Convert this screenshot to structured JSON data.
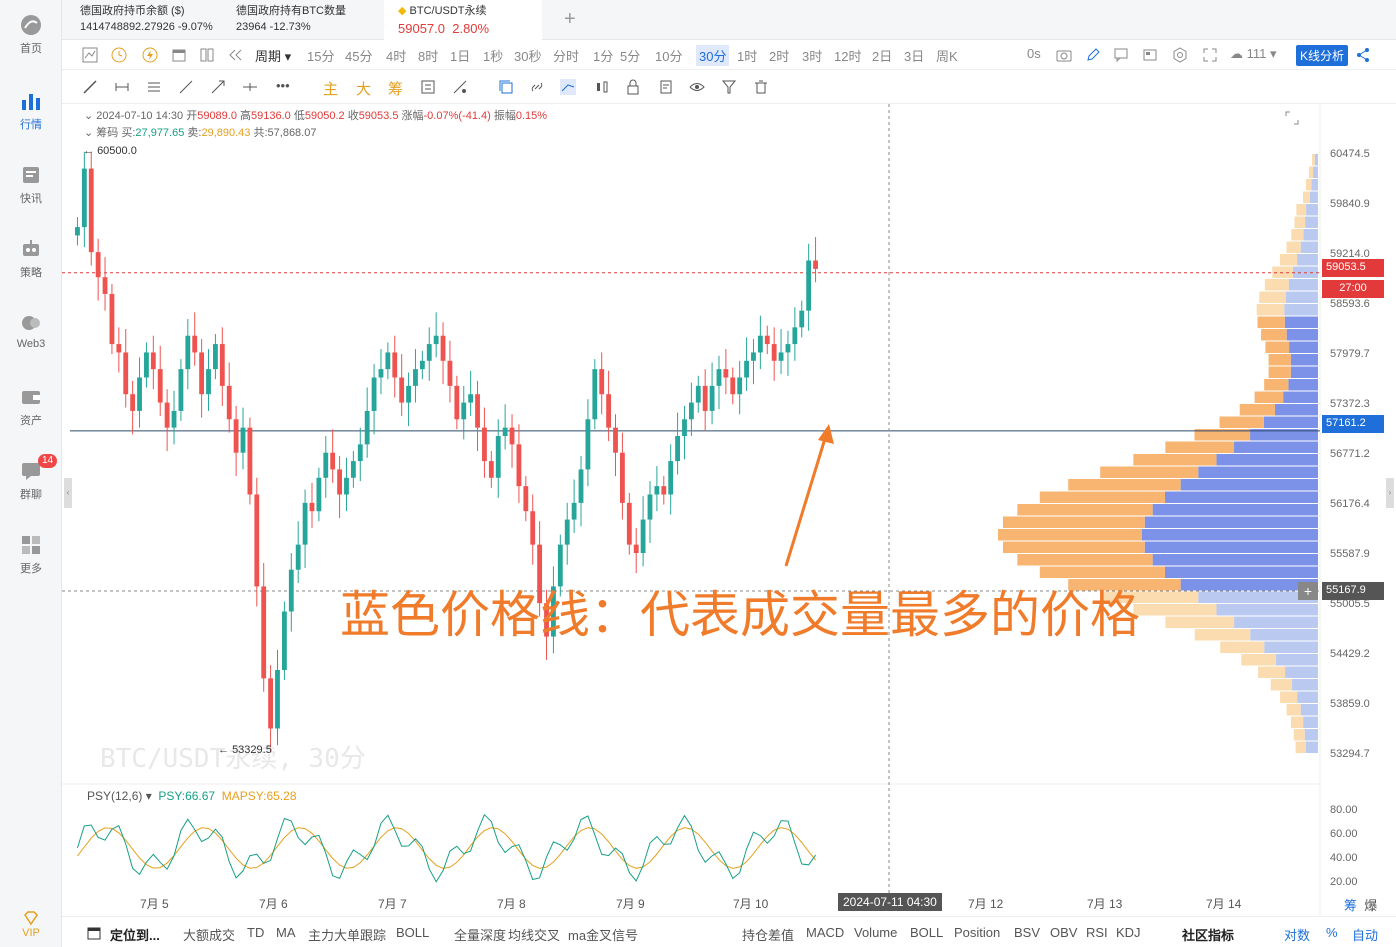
{
  "sidebar": {
    "items": [
      {
        "label": "首页"
      },
      {
        "label": "行情"
      },
      {
        "label": "快讯"
      },
      {
        "label": "策略"
      },
      {
        "label": "Web3"
      },
      {
        "label": "资产"
      },
      {
        "label": "群聊",
        "badge": "14"
      },
      {
        "label": "更多"
      }
    ],
    "vip": "VIP"
  },
  "tabs": [
    {
      "title": "德国政府持币余额 ($)",
      "value": "1414748892.27926",
      "change": "-9.07%"
    },
    {
      "title": "德国政府持有BTC数量",
      "value": "23964",
      "change": "-12.73%"
    },
    {
      "title": "BTC/USDT永续",
      "value": "59057.0",
      "change": "2.80%"
    }
  ],
  "toolbar": {
    "period_label": "周期",
    "intervals": [
      "15分",
      "45分",
      "4时",
      "8时",
      "1日",
      "1秒",
      "30秒",
      "分时",
      "1分",
      "5分",
      "10分",
      "30分",
      "1时",
      "2时",
      "3时",
      "12时",
      "2日",
      "3日",
      "周K"
    ],
    "selected": "30分",
    "countdown": "0s",
    "cloud_count": "111",
    "kline_btn": "K线分析"
  },
  "indicators_bar": [
    "主",
    "大",
    "筹"
  ],
  "ohlc": {
    "date": "2024-07-10 14:30",
    "open_label": "开",
    "open": "59089.0",
    "high_label": "高",
    "high": "59136.0",
    "low_label": "低",
    "low": "59050.2",
    "close_label": "收",
    "close": "59053.5",
    "chg_label": "涨幅",
    "chg": "-0.07%(-41.4)",
    "amp_label": "振幅",
    "amp": "0.15%"
  },
  "chips": {
    "label": "筹码",
    "buy_label": "买:",
    "buy": "27,977.65",
    "sell_label": "卖:",
    "sell": "29,890.43",
    "total_label": "共:",
    "total": "57,868.07"
  },
  "price_axis": [
    "60474.5",
    "59840.9",
    "59214.0",
    "58593.6",
    "57979.7",
    "57372.3",
    "56771.2",
    "56176.4",
    "55587.9",
    "55005.5",
    "54429.2",
    "53859.0",
    "53294.7"
  ],
  "price_tags": {
    "current": "59053.5",
    "countdown": "27:00",
    "poc": "57161.2",
    "cursor": "55167.9"
  },
  "markers": {
    "high": "60500.0",
    "low": "53329.5"
  },
  "watermark": "BTC/USDT永续, 30分",
  "annotation": "蓝色价格线：代表成交量最多的价格",
  "psy": {
    "name": "PSY(12,6)",
    "psy": "PSY:66.67",
    "mapsy": "MAPSY:65.28",
    "axis": [
      "80.00",
      "60.00",
      "40.00",
      "20.00"
    ]
  },
  "date_axis": [
    "7月 5",
    "7月 6",
    "7月 7",
    "7月 8",
    "7月 9",
    "7月 10",
    "7月 12",
    "7月 13",
    "7月 14"
  ],
  "cursor_date": "2024-07-11 04:30",
  "corner": [
    "筹",
    "爆"
  ],
  "bottom_left": [
    "定位到...",
    "大额成交",
    "TD",
    "MA",
    "主力大单跟踪",
    "BOLL",
    "全量深度",
    "均线交叉",
    "ma金叉信号"
  ],
  "bottom_right": [
    "持仓差值",
    "MACD",
    "Volume",
    "BOLL",
    "Position",
    "BSV",
    "OBV",
    "RSI",
    "KDJ",
    "社区指标"
  ],
  "bottom_far": [
    "对数",
    "%",
    "自动"
  ],
  "chart_data": {
    "type": "candlestick",
    "price_range": [
      53294.7,
      60474.5
    ],
    "current_price": 59053.5,
    "poc_price": 57161.2,
    "close": [
      59600,
      60300,
      59300,
      59000,
      58800,
      58200,
      58100,
      57600,
      57400,
      57800,
      58100,
      57900,
      57500,
      57200,
      57400,
      57900,
      58300,
      58100,
      57600,
      57900,
      58200,
      57700,
      57300,
      56900,
      57200,
      56400,
      55300,
      54200,
      53600,
      54300,
      55000,
      55500,
      55800,
      56300,
      56200,
      56600,
      56900,
      56700,
      56400,
      56600,
      56800,
      57000,
      57400,
      57800,
      57900,
      58100,
      57800,
      57500,
      57700,
      57900,
      58000,
      58200,
      58300,
      58000,
      57700,
      57300,
      57500,
      57600,
      57200,
      56800,
      56600,
      57100,
      57200,
      57000,
      56500,
      56200,
      55800,
      55100,
      54700,
      55300,
      55800,
      56100,
      56300,
      56700,
      57300,
      57900,
      57600,
      57200,
      56900,
      56300,
      55800,
      55700,
      56100,
      56400,
      56500,
      56400,
      56800,
      57100,
      57300,
      57500,
      57700,
      57400,
      57700,
      57900,
      57800,
      57600,
      57800,
      58000,
      58100,
      58300,
      58200,
      58000,
      58100,
      58200,
      58400,
      58600,
      59200,
      59100
    ]
  }
}
